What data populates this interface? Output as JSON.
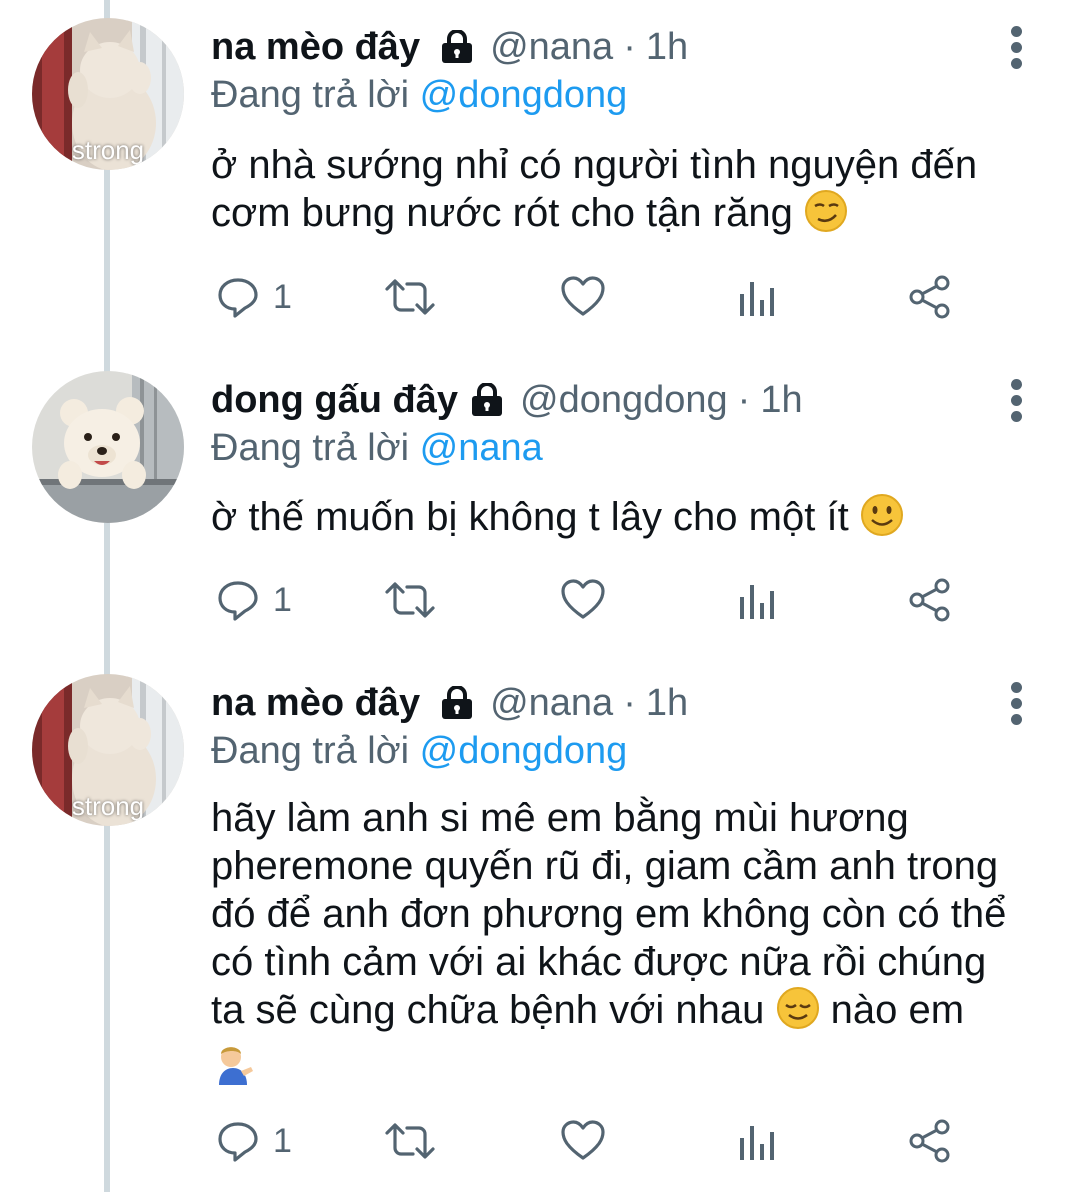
{
  "colors": {
    "text_primary": "#0f1419",
    "text_secondary": "#536471",
    "mention": "#1d9bf0",
    "thread_line": "#cfd9de"
  },
  "tweets": [
    {
      "display_name": "na mèo đây",
      "handle": "@nana",
      "separator": "·",
      "time": "1h",
      "replying_prefix": "Đang trả lời",
      "replying_to": "@dongdong",
      "avatar_caption": "strong",
      "avatar_icon": "cat-photo-avatar",
      "text_lines": [
        "ở nhà sướng nhỉ có người tình nguyện đến",
        "cơm bưng nước rót cho tận răng"
      ],
      "trailing_emoji": "smirking-face-emoji",
      "reply_count": "1"
    },
    {
      "display_name": "dong gấu đây",
      "handle": "@dongdong",
      "separator": "·",
      "time": "1h",
      "replying_prefix": "Đang trả lời",
      "replying_to": "@nana",
      "avatar_icon": "teddy-bear-photo-avatar",
      "text_lines": [
        "ờ thế muốn bị không t lây cho một ít"
      ],
      "trailing_emoji": "slightly-smiling-face-emoji",
      "reply_count": "1"
    },
    {
      "display_name": "na mèo đây",
      "handle": "@nana",
      "separator": "·",
      "time": "1h",
      "replying_prefix": "Đang trả lời",
      "replying_to": "@dongdong",
      "avatar_caption": "strong",
      "avatar_icon": "cat-photo-avatar",
      "text_lines": [
        "hãy làm anh si mê em bằng mùi hương",
        "pheremone quyến rũ đi, giam cầm anh trong",
        "đó để anh đơn phương em không còn có thể",
        "có tình cảm với ai khác được nữa rồi chúng",
        "ta sẽ cùng chữa bệnh với nhau",
        "nào em"
      ],
      "inline_emoji": "relieved-face-emoji",
      "last_line_emoji": "person-tipping-hand-emoji",
      "reply_count": "1"
    }
  ]
}
